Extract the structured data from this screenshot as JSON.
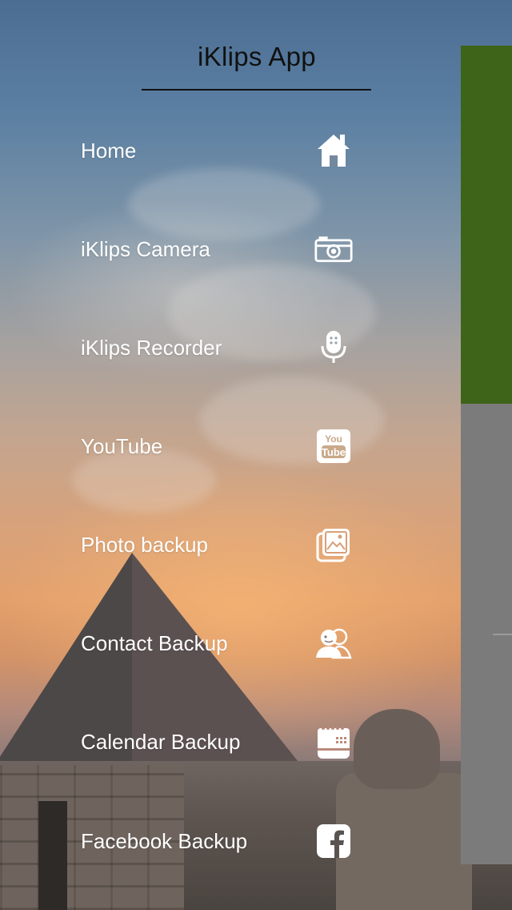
{
  "app": {
    "title": "iKlips App"
  },
  "menu": {
    "items": [
      {
        "label": "Home",
        "icon": "home-icon"
      },
      {
        "label": "iKlips Camera",
        "icon": "camera-icon"
      },
      {
        "label": "iKlips Recorder",
        "icon": "microphone-icon"
      },
      {
        "label": "YouTube",
        "icon": "youtube-icon"
      },
      {
        "label": "Photo backup",
        "icon": "photo-icon"
      },
      {
        "label": "Contact Backup",
        "icon": "contacts-icon"
      },
      {
        "label": "Calendar Backup",
        "icon": "calendar-icon"
      },
      {
        "label": "Facebook Backup",
        "icon": "facebook-icon"
      }
    ]
  },
  "colors": {
    "menu_text": "#ffffff",
    "title_text": "#111111",
    "main_panel_header": "#3d6419",
    "main_panel_body": "#7b7b7b"
  }
}
